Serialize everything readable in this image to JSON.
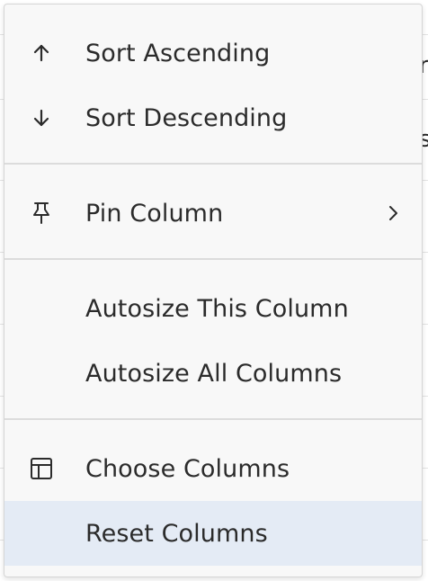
{
  "menu": {
    "items": [
      {
        "label": "Sort Ascending",
        "icon": "arrow-up-icon"
      },
      {
        "label": "Sort Descending",
        "icon": "arrow-down-icon"
      },
      {
        "label": "Pin Column",
        "icon": "pin-icon",
        "submenu": true
      },
      {
        "label": "Autosize This Column"
      },
      {
        "label": "Autosize All Columns"
      },
      {
        "label": "Choose Columns",
        "icon": "columns-icon"
      },
      {
        "label": "Reset Columns",
        "highlighted": true
      }
    ]
  },
  "background": {
    "glyphs": [
      "r",
      "s"
    ]
  },
  "colors": {
    "menu_bg": "#f8f8f8",
    "highlight": "#e4ebf5",
    "text": "#2b2b2b",
    "divider": "#dcdcdc"
  }
}
